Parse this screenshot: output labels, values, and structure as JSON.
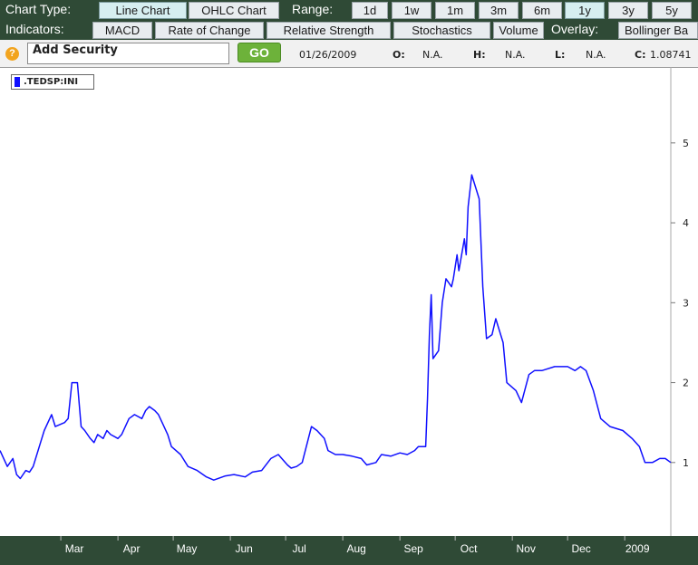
{
  "toolbar": {
    "chart_type_label": "Chart Type:",
    "line_chart": "Line Chart",
    "ohlc_chart": "OHLC Chart",
    "range_label": "Range:",
    "ranges": [
      "1d",
      "1w",
      "1m",
      "3m",
      "6m",
      "1y",
      "3y",
      "5y"
    ],
    "selected_range": "1y",
    "indicators_label": "Indicators:",
    "indicators": [
      "MACD",
      "Rate of Change",
      "Relative Strength",
      "Stochastics",
      "Volume"
    ],
    "overlay_label": "Overlay:",
    "overlay_option": "Bollinger Ba"
  },
  "security": {
    "help": "?",
    "placeholder": "Add Security",
    "go": "GO",
    "date": "01/26/2009",
    "o_label": "O:",
    "o_value": "N.A.",
    "h_label": "H:",
    "h_value": "N.A.",
    "l_label": "L:",
    "l_value": "N.A.",
    "c_label": "C:",
    "c_value": "1.08741"
  },
  "legend": {
    "symbol": ".TEDSP:INI"
  },
  "colors": {
    "toolbar_bg": "#2f4a36",
    "series": "#1010ff",
    "axis_bg": "#2f4a36",
    "go": "#6db23a"
  },
  "chart_data": {
    "type": "line",
    "title": "",
    "xlabel": "",
    "ylabel": "",
    "ylim": [
      0.08,
      5.95
    ],
    "y_ticks": [
      1,
      2,
      3,
      4,
      5
    ],
    "x_tick_labels": [
      "Mar",
      "Apr",
      "May",
      "Jun",
      "Jul",
      "Aug",
      "Sep",
      "Oct",
      "Nov",
      "Dec",
      "2009"
    ],
    "x_tick_dates": [
      "2008-03-01",
      "2008-04-01",
      "2008-05-01",
      "2008-06-01",
      "2008-07-01",
      "2008-08-01",
      "2008-09-01",
      "2008-10-01",
      "2008-11-01",
      "2008-12-01",
      "2009-01-01"
    ],
    "xlim": [
      "2008-01-28",
      "2009-01-26"
    ],
    "grid": false,
    "series": [
      {
        "name": ".TEDSP:INI",
        "x": [
          "2008-01-28",
          "2008-02-01",
          "2008-02-04",
          "2008-02-06",
          "2008-02-08",
          "2008-02-11",
          "2008-02-13",
          "2008-02-15",
          "2008-02-19",
          "2008-02-21",
          "2008-02-25",
          "2008-02-27",
          "2008-03-03",
          "2008-03-05",
          "2008-03-07",
          "2008-03-10",
          "2008-03-12",
          "2008-03-14",
          "2008-03-17",
          "2008-03-19",
          "2008-03-21",
          "2008-03-24",
          "2008-03-26",
          "2008-03-28",
          "2008-04-01",
          "2008-04-03",
          "2008-04-07",
          "2008-04-10",
          "2008-04-14",
          "2008-04-16",
          "2008-04-18",
          "2008-04-21",
          "2008-04-23",
          "2008-04-25",
          "2008-04-28",
          "2008-04-30",
          "2008-05-05",
          "2008-05-09",
          "2008-05-14",
          "2008-05-19",
          "2008-05-23",
          "2008-05-29",
          "2008-06-03",
          "2008-06-09",
          "2008-06-13",
          "2008-06-18",
          "2008-06-23",
          "2008-06-27",
          "2008-07-02",
          "2008-07-04",
          "2008-07-07",
          "2008-07-10",
          "2008-07-15",
          "2008-07-18",
          "2008-07-22",
          "2008-07-24",
          "2008-07-28",
          "2008-08-01",
          "2008-08-06",
          "2008-08-11",
          "2008-08-14",
          "2008-08-19",
          "2008-08-22",
          "2008-08-27",
          "2008-09-01",
          "2008-09-05",
          "2008-09-09",
          "2008-09-11",
          "2008-09-15",
          "2008-09-16",
          "2008-09-17",
          "2008-09-18",
          "2008-09-19",
          "2008-09-22",
          "2008-09-24",
          "2008-09-26",
          "2008-09-29",
          "2008-09-30",
          "2008-10-02",
          "2008-10-03",
          "2008-10-06",
          "2008-10-07",
          "2008-10-08",
          "2008-10-09",
          "2008-10-10",
          "2008-10-14",
          "2008-10-16",
          "2008-10-18",
          "2008-10-21",
          "2008-10-23",
          "2008-10-27",
          "2008-10-29",
          "2008-11-03",
          "2008-11-06",
          "2008-11-10",
          "2008-11-13",
          "2008-11-17",
          "2008-11-24",
          "2008-12-01",
          "2008-12-05",
          "2008-12-08",
          "2008-12-11",
          "2008-12-15",
          "2008-12-19",
          "2008-12-24",
          "2008-12-31",
          "2009-01-05",
          "2009-01-09",
          "2009-01-12",
          "2009-01-16",
          "2009-01-20",
          "2009-01-23",
          "2009-01-26"
        ],
        "y": [
          1.15,
          0.95,
          1.05,
          0.85,
          0.8,
          0.9,
          0.88,
          0.95,
          1.25,
          1.4,
          1.6,
          1.45,
          1.5,
          1.55,
          2.0,
          2.0,
          1.45,
          1.4,
          1.3,
          1.25,
          1.35,
          1.3,
          1.4,
          1.35,
          1.3,
          1.35,
          1.55,
          1.6,
          1.55,
          1.65,
          1.7,
          1.65,
          1.6,
          1.5,
          1.35,
          1.2,
          1.1,
          0.95,
          0.9,
          0.82,
          0.78,
          0.83,
          0.85,
          0.82,
          0.88,
          0.9,
          1.05,
          1.1,
          0.97,
          0.93,
          0.95,
          1.0,
          1.45,
          1.4,
          1.3,
          1.15,
          1.1,
          1.1,
          1.08,
          1.05,
          0.97,
          1.0,
          1.1,
          1.08,
          1.12,
          1.1,
          1.15,
          1.2,
          1.2,
          1.8,
          2.6,
          3.1,
          2.3,
          2.4,
          3.0,
          3.3,
          3.2,
          3.3,
          3.6,
          3.4,
          3.8,
          3.6,
          4.2,
          4.4,
          4.6,
          4.3,
          3.2,
          2.55,
          2.6,
          2.8,
          2.5,
          2.0,
          1.9,
          1.75,
          2.1,
          2.15,
          2.15,
          2.2,
          2.2,
          2.15,
          2.2,
          2.15,
          1.9,
          1.55,
          1.45,
          1.4,
          1.3,
          1.2,
          1.0,
          1.0,
          1.05,
          1.05,
          1.0
        ]
      }
    ]
  }
}
